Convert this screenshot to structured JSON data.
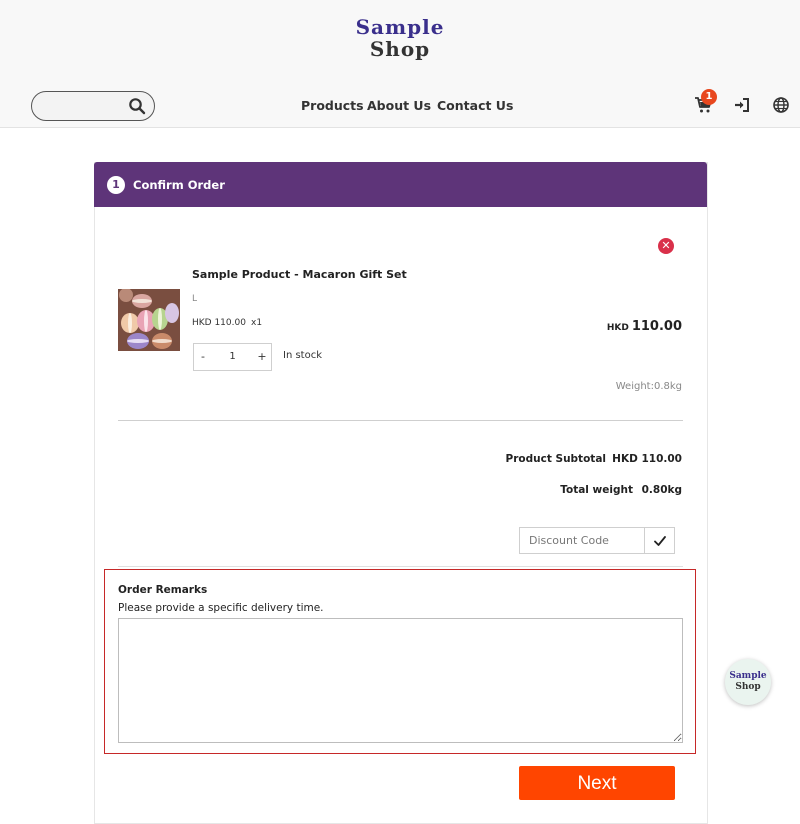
{
  "header": {
    "logo_line1": "Sample",
    "logo_line2": "Shop",
    "search": {
      "placeholder": ""
    },
    "nav": [
      "Products",
      "About Us",
      "Contact Us"
    ],
    "cart_count": "1"
  },
  "checkout": {
    "step_number": "1",
    "step_title": "Confirm Order",
    "item": {
      "name": "Sample Product - Macaron Gift Set",
      "variant": "L",
      "unit_price": "HKD 110.00",
      "quantity_text": "x1",
      "currency": "HKD",
      "line_total": "110.00",
      "quantity": "1",
      "minus": "-",
      "plus": "+",
      "stock": "In stock",
      "weight": "Weight:0.8kg"
    },
    "summary": {
      "subtotal_label": "Product Subtotal",
      "subtotal_value": "HKD 110.00",
      "weight_label": "Total weight",
      "weight_value": "0.80kg"
    },
    "discount": {
      "placeholder": "Discount Code"
    },
    "remarks": {
      "title": "Order Remarks",
      "hint": "Please provide a specific delivery time."
    },
    "next_label": "Next"
  },
  "float_logo": {
    "line1": "Sample",
    "line2": "Shop"
  },
  "colors": {
    "header_purple": "#5e3479",
    "next_orange": "#ff4500",
    "remove_red": "#d9304a",
    "remarks_border": "#c62828"
  },
  "icons": [
    "search-icon",
    "cart-icon",
    "login-icon",
    "globe-icon",
    "close-icon",
    "check-icon"
  ]
}
